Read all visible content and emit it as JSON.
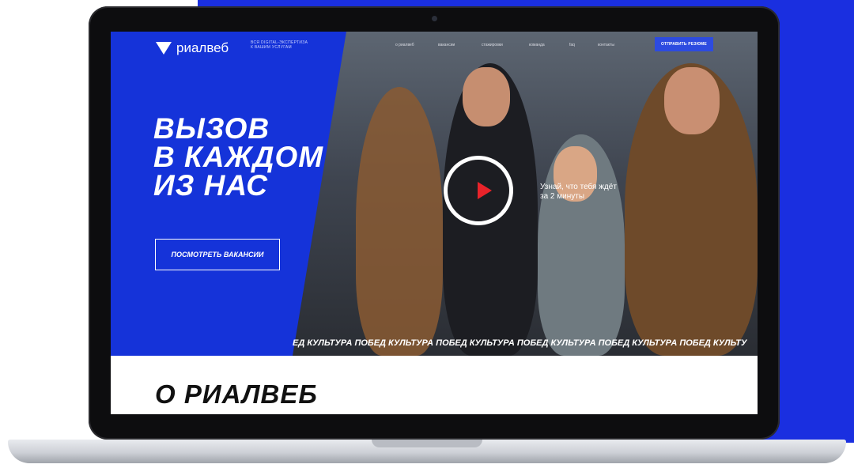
{
  "colors": {
    "brand_blue": "#1533d9",
    "play_red": "#e8232a",
    "cta_blue": "#2d4be0"
  },
  "header": {
    "logo_text": "риалвеб",
    "tagline_line1": "ВСЯ DIGITAL-ЭКСПЕРТИЗА",
    "tagline_line2": "К ВАШИМ УСЛУГАМ",
    "nav": [
      {
        "label": "о риалвеб"
      },
      {
        "label": "вакансии"
      },
      {
        "label": "стажировки"
      },
      {
        "label": "команда"
      },
      {
        "label": "faq"
      },
      {
        "label": "контакты"
      }
    ],
    "cta_label": "ОТПРАВИТЬ РЕЗЮМЕ"
  },
  "hero": {
    "headline_line1": "ВЫЗОВ",
    "headline_line2": "В КАЖДОМ",
    "headline_line3": "ИЗ НАС",
    "vacancies_button": "ПОСМОТРЕТЬ ВАКАНСИИ",
    "video_caption_line1": "Узнай, что тебя ждёт",
    "video_caption_line2": "за 2 минуты",
    "ticker_text": "ЕД  КУЛЬТУРА ПОБЕД  КУЛЬТУРА ПОБЕД  КУЛЬТУРА ПОБЕД  КУЛЬТУРА ПОБЕД  КУЛЬТУРА ПОБЕД  КУЛЬТУ"
  },
  "about": {
    "title": "О РИАЛВЕБ"
  },
  "icons": {
    "logo": "rialweb-triangle-logo",
    "play": "play-icon"
  }
}
